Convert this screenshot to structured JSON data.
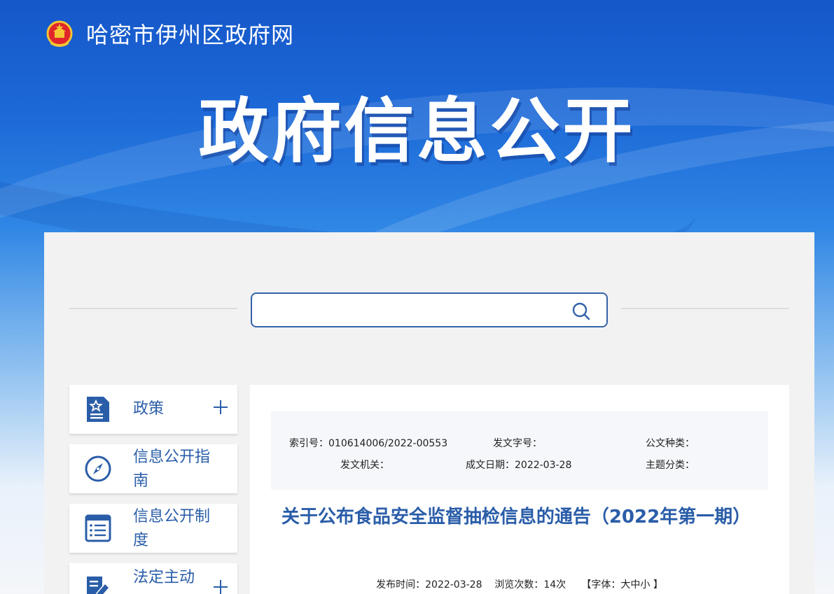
{
  "header": {
    "site_name": "哈密市伊州区政府网",
    "hero_title": "政府信息公开"
  },
  "search": {
    "placeholder": "",
    "value": ""
  },
  "sidebar": {
    "items": [
      {
        "label": "政策",
        "icon": "policy-document-icon",
        "expandable": true
      },
      {
        "label": "信息公开指南",
        "icon": "compass-icon",
        "expandable": false
      },
      {
        "label": "信息公开制度",
        "icon": "list-document-icon",
        "expandable": false
      },
      {
        "label": "法定主动",
        "icon": "edit-document-icon",
        "expandable": true
      }
    ]
  },
  "document": {
    "meta": {
      "index_label": "索引号：",
      "index_value": "010614006/2022-00553",
      "doc_no_label": "发文字号：",
      "doc_no_value": "",
      "doc_type_label": "公文种类：",
      "doc_type_value": "",
      "issuer_label": "发文机关：",
      "issuer_value": "",
      "date_label": "成文日期：",
      "date_value": "2022-03-28",
      "topic_label": "主题分类：",
      "topic_value": ""
    },
    "title": "关于公布食品安全监督抽检信息的通告（2022年第一期）",
    "publish": {
      "time_label": "发布时间：",
      "time_value": "2022-03-28",
      "views_label": "浏览次数：",
      "views_value": "14次",
      "font_label": "【字体：",
      "font_large": "大",
      "font_medium": "中",
      "font_small": "小",
      "font_close": " 】"
    }
  },
  "colors": {
    "accent": "#2a5da8",
    "search_border": "#3463a8",
    "banner_top": "#1557c9",
    "panel_bg": "#f2f2f2"
  }
}
